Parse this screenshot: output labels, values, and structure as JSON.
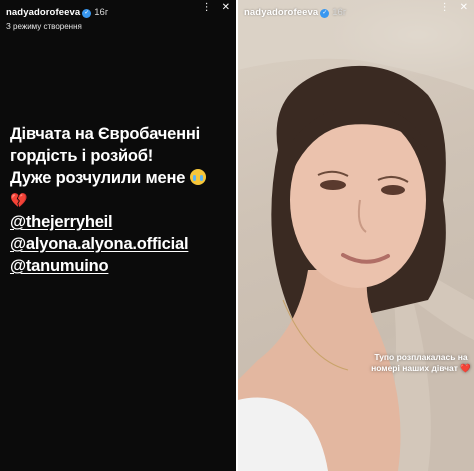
{
  "left_story": {
    "username": "nadyadorofeeva",
    "time": "16г",
    "subtitle": "З режиму створення",
    "text_lines": [
      "Дівчата на Євробаченні",
      "гордість і розйоб!",
      "Дуже розчулили мене"
    ],
    "mentions": [
      "@thejerryheil",
      "@alyona.alyona.official",
      "@tanumuino"
    ],
    "emoji": "crying-face",
    "heart": "💔"
  },
  "right_story": {
    "username": "nadyadorofeeva",
    "time": "16г",
    "caption_line1": "Тупо розплакалась на",
    "caption_line2": "номері наших дівчат",
    "caption_heart": "❤️"
  },
  "icons": {
    "more": "more-icon",
    "close": "close-icon"
  }
}
